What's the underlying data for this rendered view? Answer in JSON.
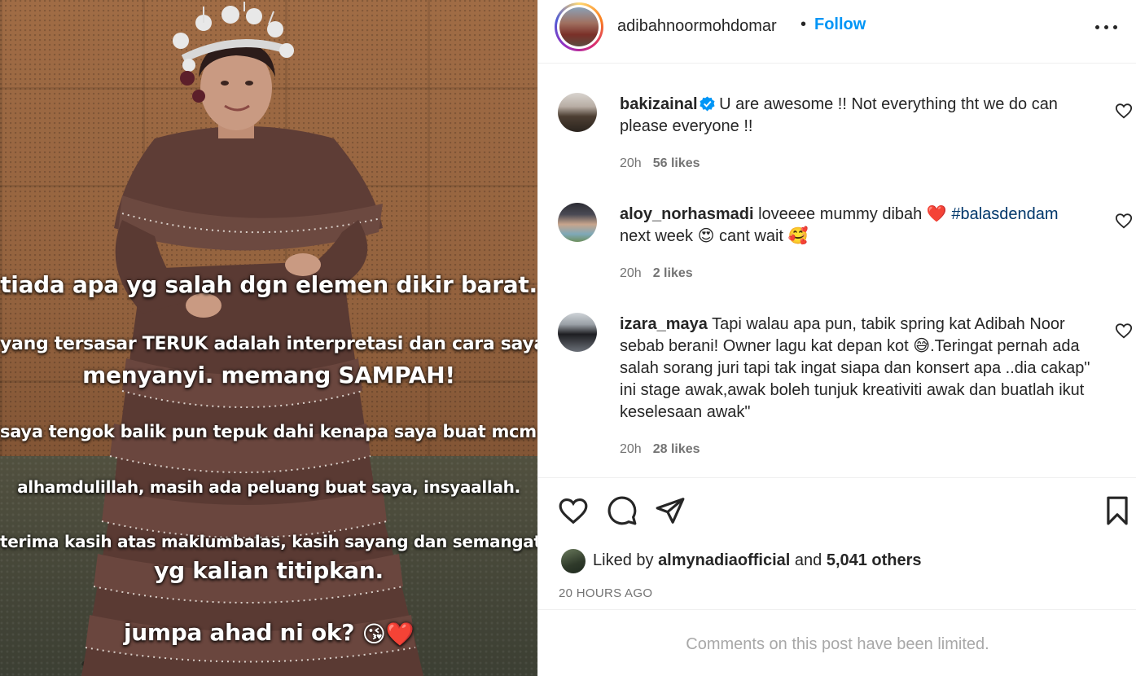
{
  "post_image": {
    "overlay_lines": [
      "tiada apa yg salah dgn elemen dikir barat.",
      "yang tersasar TERUK adalah interpretasi dan cara saya",
      "menyanyi. memang SAMPAH!",
      "saya tengok balik pun tepuk dahi kenapa saya buat mcm tu.",
      "alhamdulillah, masih ada peluang buat saya, insyaallah.",
      "terima kasih atas maklumbalas, kasih sayang dan semangat",
      "yg kalian titipkan.",
      "jumpa ahad ni ok?"
    ],
    "last_line_emojis": "😘❤️"
  },
  "header": {
    "username": "adibahnoormohdomar",
    "separator": "•",
    "follow_label": "Follow",
    "more_icon": "more-horizontal-icon"
  },
  "comments": [
    {
      "username": "bakizainal",
      "verified": true,
      "text": "U are awesome !! Not everything tht we do can please everyone !!",
      "time": "20h",
      "likes": "56 likes"
    },
    {
      "username": "aloy_norhasmadi",
      "verified": false,
      "text_parts": [
        "loveeee mummy dibah ",
        "❤️",
        " ",
        "#balasdendam",
        " next week ",
        "😍",
        " cant wait ",
        "🥰"
      ],
      "time": "20h",
      "likes": "2 likes"
    },
    {
      "username": "izara_maya",
      "verified": false,
      "text_before_emoji": "Tapi walau apa pun, tabik spring kat Adibah Noor sebab berani! Owner lagu kat depan kot ",
      "emoji": "😅",
      "text_after_emoji": ".Teringat pernah ada salah sorang juri tapi tak ingat siapa dan konsert apa ..dia cakap\" ini stage awak,awak boleh tunjuk kreativiti awak dan buatlah ikut keselesaan awak\"",
      "time": "20h",
      "likes": "28 likes"
    }
  ],
  "actions": {
    "like_icon": "heart-icon",
    "comment_icon": "comment-icon",
    "share_icon": "send-icon",
    "save_icon": "bookmark-icon"
  },
  "liked_by": {
    "prefix": "Liked by ",
    "user": "almynadiaofficial",
    "middle": " and ",
    "others": "5,041 others"
  },
  "timestamp": "20 HOURS AGO",
  "comments_limited": "Comments on this post have been limited.",
  "colors": {
    "link_blue": "#0095f6",
    "hashtag": "#00376b",
    "meta_gray": "#737373",
    "verified": "#0095f6"
  }
}
